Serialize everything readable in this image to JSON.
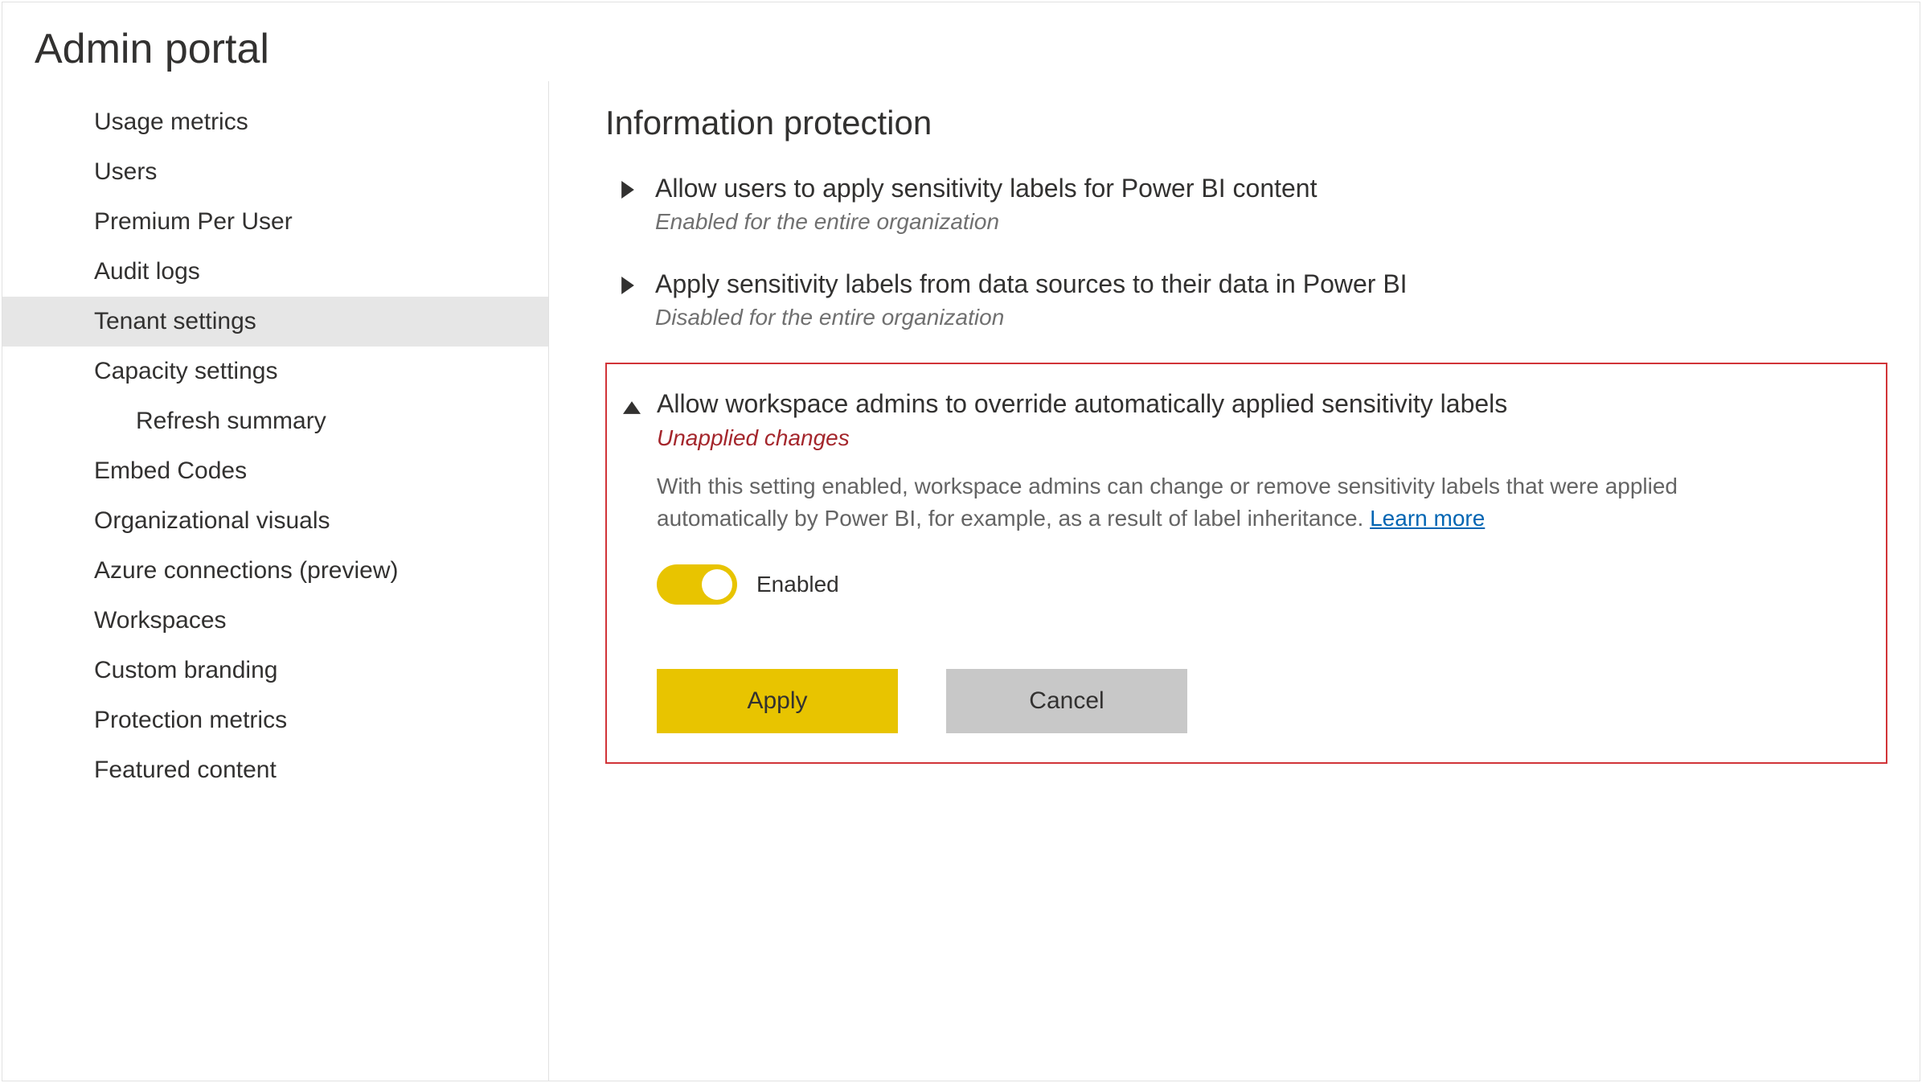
{
  "page_title": "Admin portal",
  "sidebar": {
    "items": [
      {
        "label": "Usage metrics",
        "nested": false,
        "active": false
      },
      {
        "label": "Users",
        "nested": false,
        "active": false
      },
      {
        "label": "Premium Per User",
        "nested": false,
        "active": false
      },
      {
        "label": "Audit logs",
        "nested": false,
        "active": false
      },
      {
        "label": "Tenant settings",
        "nested": false,
        "active": true
      },
      {
        "label": "Capacity settings",
        "nested": false,
        "active": false
      },
      {
        "label": "Refresh summary",
        "nested": true,
        "active": false
      },
      {
        "label": "Embed Codes",
        "nested": false,
        "active": false
      },
      {
        "label": "Organizational visuals",
        "nested": false,
        "active": false
      },
      {
        "label": "Azure connections (preview)",
        "nested": false,
        "active": false
      },
      {
        "label": "Workspaces",
        "nested": false,
        "active": false
      },
      {
        "label": "Custom branding",
        "nested": false,
        "active": false
      },
      {
        "label": "Protection metrics",
        "nested": false,
        "active": false
      },
      {
        "label": "Featured content",
        "nested": false,
        "active": false
      }
    ]
  },
  "main": {
    "section_title": "Information protection",
    "settings": [
      {
        "title": "Allow users to apply sensitivity labels for Power BI content",
        "status": "Enabled for the entire organization",
        "expanded": false
      },
      {
        "title": "Apply sensitivity labels from data sources to their data in Power BI",
        "status": "Disabled for the entire organization",
        "expanded": false
      },
      {
        "title": "Allow workspace admins to override automatically applied sensitivity labels",
        "status": "Unapplied changes",
        "expanded": true,
        "description": "With this setting enabled, workspace admins can change or remove sensitivity labels that were applied automatically by Power BI, for example, as a result of label inheritance.",
        "learn_more": "Learn more",
        "toggle_state": "Enabled",
        "apply_label": "Apply",
        "cancel_label": "Cancel"
      }
    ]
  }
}
